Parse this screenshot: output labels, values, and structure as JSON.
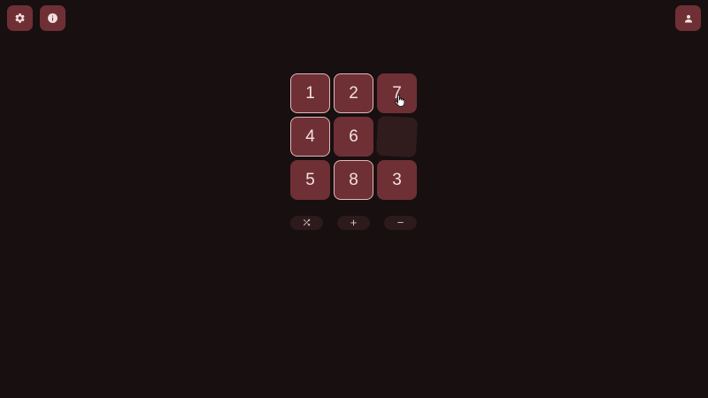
{
  "toolbar": {
    "settings_icon": "gear-icon",
    "info_icon": "info-icon",
    "account_icon": "person-icon"
  },
  "board": {
    "rows": [
      [
        {
          "label": "1",
          "correct": true
        },
        {
          "label": "2",
          "correct": true
        },
        {
          "label": "7",
          "correct": false
        }
      ],
      [
        {
          "label": "4",
          "correct": true
        },
        {
          "label": "6",
          "correct": false
        },
        null
      ],
      [
        {
          "label": "5",
          "correct": false
        },
        {
          "label": "8",
          "correct": true
        },
        {
          "label": "3",
          "correct": false
        }
      ]
    ],
    "empty_position": [
      1,
      2
    ]
  },
  "controls": {
    "shuffle_icon": "shuffle-icon",
    "plus_label": "+",
    "minus_label": "−"
  },
  "colors": {
    "background": "#170f10",
    "tile": "#6e3035",
    "tile_text": "#f3dfe0",
    "correct_border": "#e3b7ba",
    "empty_slot": "#301b1d",
    "control_bg": "#2c1a1c"
  }
}
